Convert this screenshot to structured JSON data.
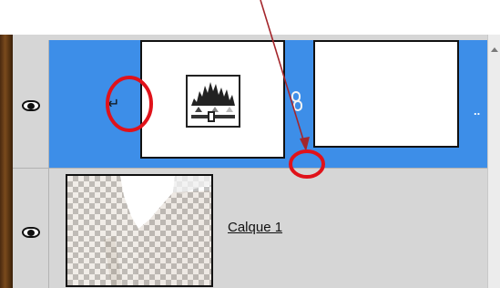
{
  "layers_panel": {
    "layers": [
      {
        "kind": "adjustment",
        "adjustment_icon": "levels-icon",
        "visibility_icon": "eye-icon",
        "clipping_icon": "clipping-arrow-icon",
        "link_icon": "chain-link-icon",
        "more_indicator": "..",
        "selected": true
      },
      {
        "kind": "pixel",
        "name": "Calque 1",
        "visibility_icon": "eye-icon",
        "thumbnail": "transparent-checkerboard-photo",
        "selected": false
      }
    ],
    "colors": {
      "selected_row": "#3d8ee8",
      "panel_bg": "#d6d6d6",
      "annotation_red": "#e0121a",
      "annotation_arrow": "#a4262c"
    }
  }
}
